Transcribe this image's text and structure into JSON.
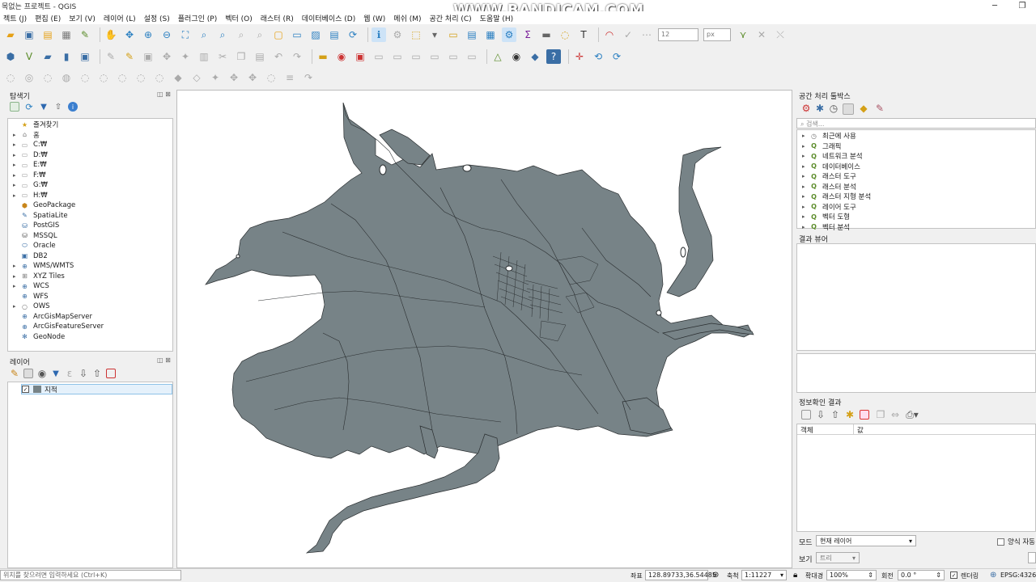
{
  "window": {
    "title": "목없는 프로젝트 - QGIS",
    "watermark": "WWW.BANDICAM.COM"
  },
  "menu": [
    "젝트 (J)",
    "편집 (E)",
    "보기 (V)",
    "레이어 (L)",
    "설정 (S)",
    "플러그인 (P)",
    "벡터 (O)",
    "래스터 (R)",
    "데이터베이스 (D)",
    "웹 (W)",
    "메쉬 (M)",
    "공간 처리 (C)",
    "도움말 (H)"
  ],
  "toolbar": {
    "font_size_value": "12",
    "font_unit": "px"
  },
  "browser": {
    "title": "탐색기",
    "items": [
      {
        "label": "즐겨찾기",
        "icon": "star-icon",
        "expand": false
      },
      {
        "label": "홈",
        "icon": "home-folder-icon",
        "expand": true
      },
      {
        "label": "C:₩",
        "icon": "folder-icon",
        "expand": true
      },
      {
        "label": "D:₩",
        "icon": "folder-icon",
        "expand": true
      },
      {
        "label": "E:₩",
        "icon": "folder-icon",
        "expand": true
      },
      {
        "label": "F:₩",
        "icon": "folder-icon",
        "expand": true
      },
      {
        "label": "G:₩",
        "icon": "folder-icon",
        "expand": true
      },
      {
        "label": "H:₩",
        "icon": "folder-icon",
        "expand": true
      },
      {
        "label": "GeoPackage",
        "icon": "geopackage-icon",
        "expand": false
      },
      {
        "label": "SpatiaLite",
        "icon": "spatialite-icon",
        "expand": false
      },
      {
        "label": "PostGIS",
        "icon": "postgis-icon",
        "expand": false
      },
      {
        "label": "MSSQL",
        "icon": "mssql-icon",
        "expand": false
      },
      {
        "label": "Oracle",
        "icon": "oracle-icon",
        "expand": false
      },
      {
        "label": "DB2",
        "icon": "db2-icon",
        "expand": false
      },
      {
        "label": "WMS/WMTS",
        "icon": "globe-icon",
        "expand": true
      },
      {
        "label": "XYZ Tiles",
        "icon": "grid-globe-icon",
        "expand": true
      },
      {
        "label": "WCS",
        "icon": "globe-icon",
        "expand": true
      },
      {
        "label": "WFS",
        "icon": "globe-icon",
        "expand": false
      },
      {
        "label": "OWS",
        "icon": "circle-icon",
        "expand": true
      },
      {
        "label": "ArcGisMapServer",
        "icon": "globe-icon",
        "expand": false
      },
      {
        "label": "ArcGisFeatureServer",
        "icon": "globe-icon",
        "expand": false
      },
      {
        "label": "GeoNode",
        "icon": "geonode-icon",
        "expand": false
      }
    ]
  },
  "layers": {
    "title": "레이어",
    "items": [
      {
        "label": "지적",
        "checked": true,
        "color": "#778387"
      }
    ]
  },
  "processing": {
    "title": "공간 처리 툴박스",
    "search_placeholder": "검색...",
    "items": [
      "최근에 사용",
      "그래픽",
      "네트워크 분석",
      "데이터베이스",
      "래스터 도구",
      "래스터 분석",
      "래스터 지형 분석",
      "레이어 도구",
      "벡터 도형",
      "벡터 분석"
    ]
  },
  "results_viewer": {
    "title": "결과 뷰어"
  },
  "identify": {
    "title": "정보확인 결과",
    "col_feature": "객체",
    "col_value": "값",
    "mode_label": "모드",
    "mode_value": "현재 레이어",
    "view_label": "보기",
    "view_value": "트리",
    "auto_open_label": "양식 자동"
  },
  "status": {
    "search_placeholder": "위치를 찾으려면 입력하세요 (Ctrl+K)",
    "coord_label": "좌표",
    "coord_value": "128.89733,36.54485",
    "scale_label": "축척",
    "scale_value": "1:11227",
    "magnifier_label": "확대경",
    "magnifier_value": "100%",
    "rotation_label": "회전",
    "rotation_value": "0.0 °",
    "render_label": "렌더링",
    "crs": "EPSG:4326"
  },
  "colors": {
    "parcel_fill": "#778387",
    "parcel_stroke": "#2a2e30"
  }
}
